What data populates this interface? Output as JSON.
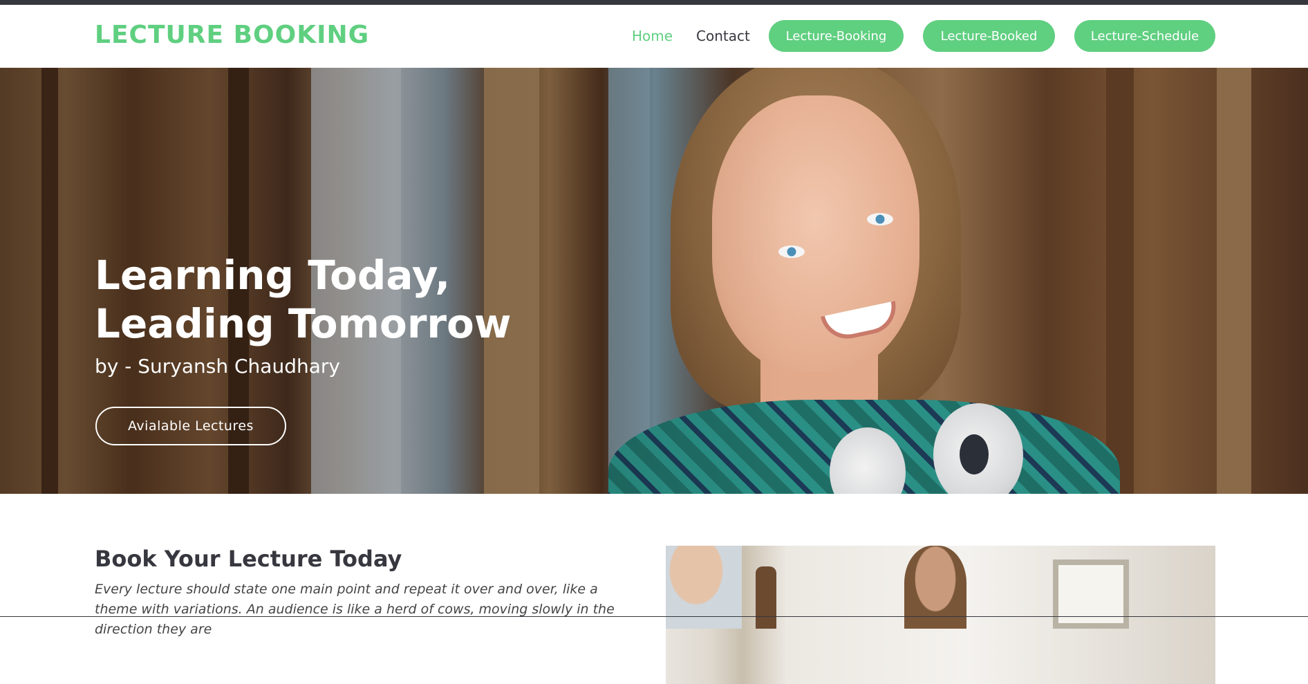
{
  "header": {
    "logo": "LECTURE BOOKING",
    "nav": {
      "home": "Home",
      "contact": "Contact"
    },
    "buttons": {
      "booking": "Lecture-Booking",
      "booked": "Lecture-Booked",
      "schedule": "Lecture-Schedule"
    }
  },
  "hero": {
    "title_line1": "Learning Today,",
    "title_line2": "Leading Tomorrow",
    "subtitle": "by - Suryansh Chaudhary",
    "button": "Avialable Lectures"
  },
  "about": {
    "title": "Book Your Lecture Today",
    "text": "Every lecture should state one main point and repeat it over and over, like a theme with variations. An audience is like a herd of cows, moving slowly in the direction they are"
  },
  "colors": {
    "accent": "#5fcf80",
    "dark": "#37373f",
    "white": "#ffffff"
  }
}
